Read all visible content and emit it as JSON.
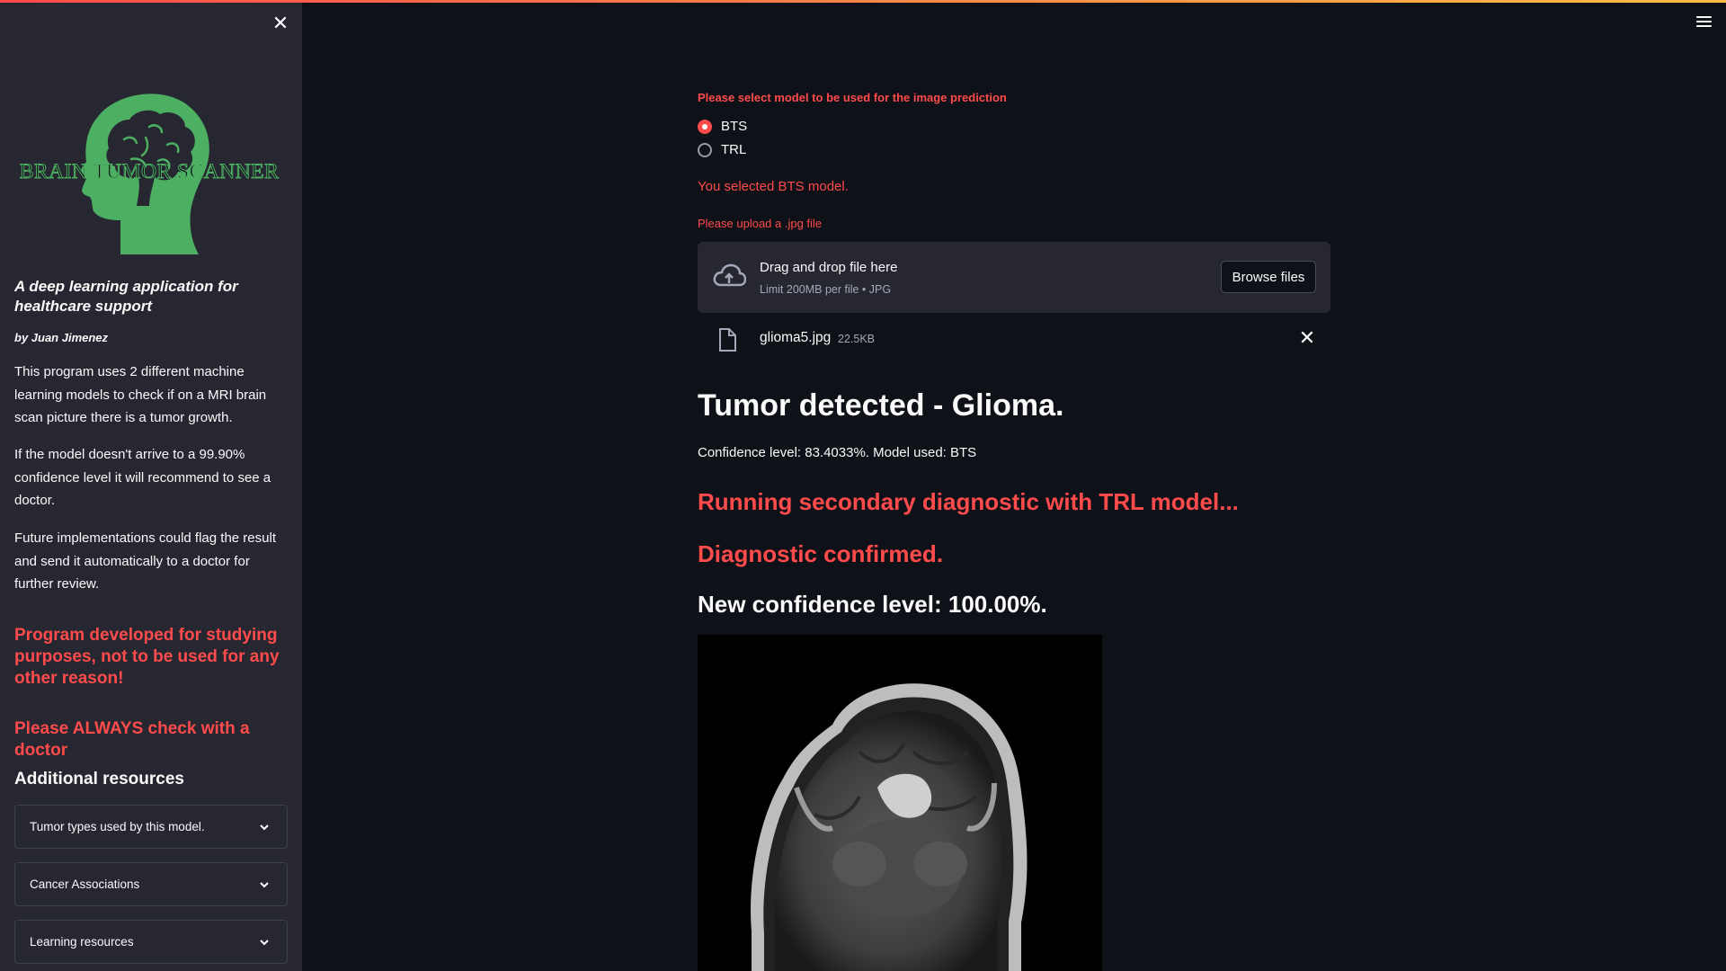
{
  "sidebar": {
    "logo_text": "BRAIN TUMOR SCANNER",
    "subtitle": "A deep learning application for healthcare support",
    "author": "by Juan Jimenez",
    "paragraphs": [
      "This program uses 2 different machine learning models to check if on a MRI brain scan picture there is a tumor growth.",
      "If the model doesn't arrive to a 99.90% confidence level it will recommend to see a doctor.",
      "Future implementations could flag the result and send it automatically to a doctor for further review."
    ],
    "warning": "Program developed for studying purposes, not to be used for any other reason!",
    "warning2": "Please ALWAYS check with a doctor",
    "resources_heading": "Additional resources",
    "expanders": [
      {
        "label": "Tumor types used by this model."
      },
      {
        "label": "Cancer Associations"
      },
      {
        "label": "Learning resources"
      }
    ]
  },
  "main": {
    "model_prompt": "Please select model to be used for the image prediction",
    "models": [
      {
        "label": "BTS",
        "selected": true
      },
      {
        "label": "TRL",
        "selected": false
      }
    ],
    "selected_message": "You selected BTS model.",
    "upload_prompt": "Please upload a .jpg file",
    "uploader": {
      "title": "Drag and drop file here",
      "limit": "Limit 200MB per file • JPG",
      "browse_label": "Browse files"
    },
    "file": {
      "name": "glioma5.jpg",
      "size": "22.5KB"
    },
    "result_title": "Tumor detected - Glioma.",
    "confidence_text": "Confidence level: 83.4033%. Model used: BTS",
    "secondary_text": "Running secondary diagnostic with TRL model...",
    "confirmed_text": "Diagnostic confirmed.",
    "new_confidence_text": "New confidence level: 100.00%."
  },
  "colors": {
    "accent": "#ff4b4b",
    "background": "#0e1117",
    "sidebar": "#262730",
    "logo_green": "#4caf62"
  },
  "icons": [
    "close-icon",
    "menu-icon",
    "cloud-upload-icon",
    "file-icon",
    "chevron-down-icon"
  ]
}
